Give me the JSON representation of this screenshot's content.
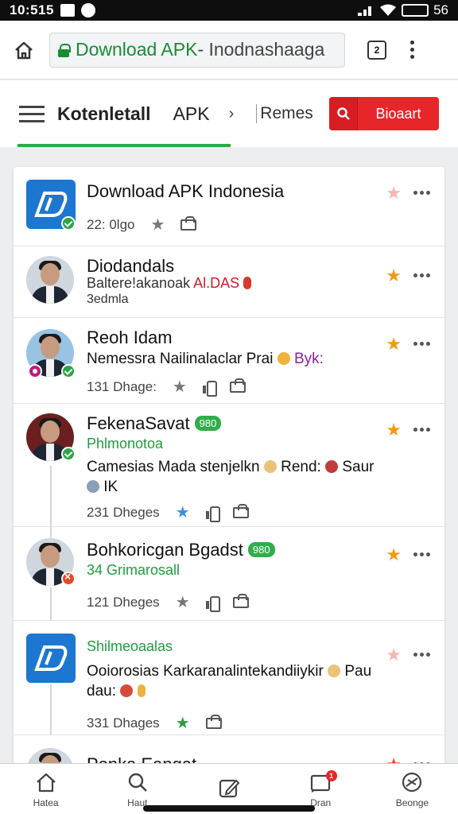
{
  "status": {
    "time": "10:515",
    "battery": "56"
  },
  "browser": {
    "url_site": "Download APK",
    "url_rest": " - Inodnashaaga",
    "tab_count": "2"
  },
  "nav": {
    "site_title": "Kotenletall",
    "section": "APK",
    "chevron": "›",
    "breadcrumb": "Remes",
    "download_label": "Bioaart"
  },
  "feed": [
    {
      "name": "Download APK Indonesia",
      "meta_count": "22: 0lgo",
      "pinned": "light"
    },
    {
      "name": "Diodandals",
      "sub": "Baltere!akanoak",
      "sub_suffix": "Al.DAS",
      "sub2": "3edmla",
      "pinned": "gold"
    },
    {
      "name": "Reoh Idam",
      "content": "Nemessra Nailinalaclar Prai",
      "content_tag": "Byk:",
      "meta_count": "131 Dhage:",
      "pinned": "gold"
    },
    {
      "name": "FekenaSavat",
      "tag": "980",
      "sub": "Phlmonotoa",
      "content": "Camesias Mada stenjelkn",
      "content_mid": "Rend:",
      "content_end": "Saur",
      "content_line2": "IK",
      "meta_count": "231 Dheges",
      "pinned": "gold"
    },
    {
      "name": "Bohkoricgan Bgadst",
      "tag": "980",
      "sub": "34 Grimarosall",
      "meta_count": "121 Dheges",
      "pinned": "gold"
    },
    {
      "sub": "Shilmeoaalas",
      "content": "Ooiorosias Karkaranalintekandiiykir",
      "content_end": "Pau",
      "content_line2": "dau:",
      "meta_count": "331 Dhages",
      "pinned": "light"
    },
    {
      "name": "Ponka Eangat",
      "pinned": "red"
    }
  ],
  "bottom_nav": [
    {
      "label": "Hatea",
      "icon": "home-icon"
    },
    {
      "label": "Haut",
      "icon": "search-icon"
    },
    {
      "label": "",
      "icon": "edit-icon"
    },
    {
      "label": "Dran",
      "icon": "notifications-icon",
      "badge": "1"
    },
    {
      "label": "Beonge",
      "icon": "settings-icon"
    }
  ],
  "colors": {
    "brand_green": "#2eaa46",
    "accent_red": "#e8262a",
    "app_blue": "#1c77d0",
    "star_gold": "#f29a14"
  }
}
